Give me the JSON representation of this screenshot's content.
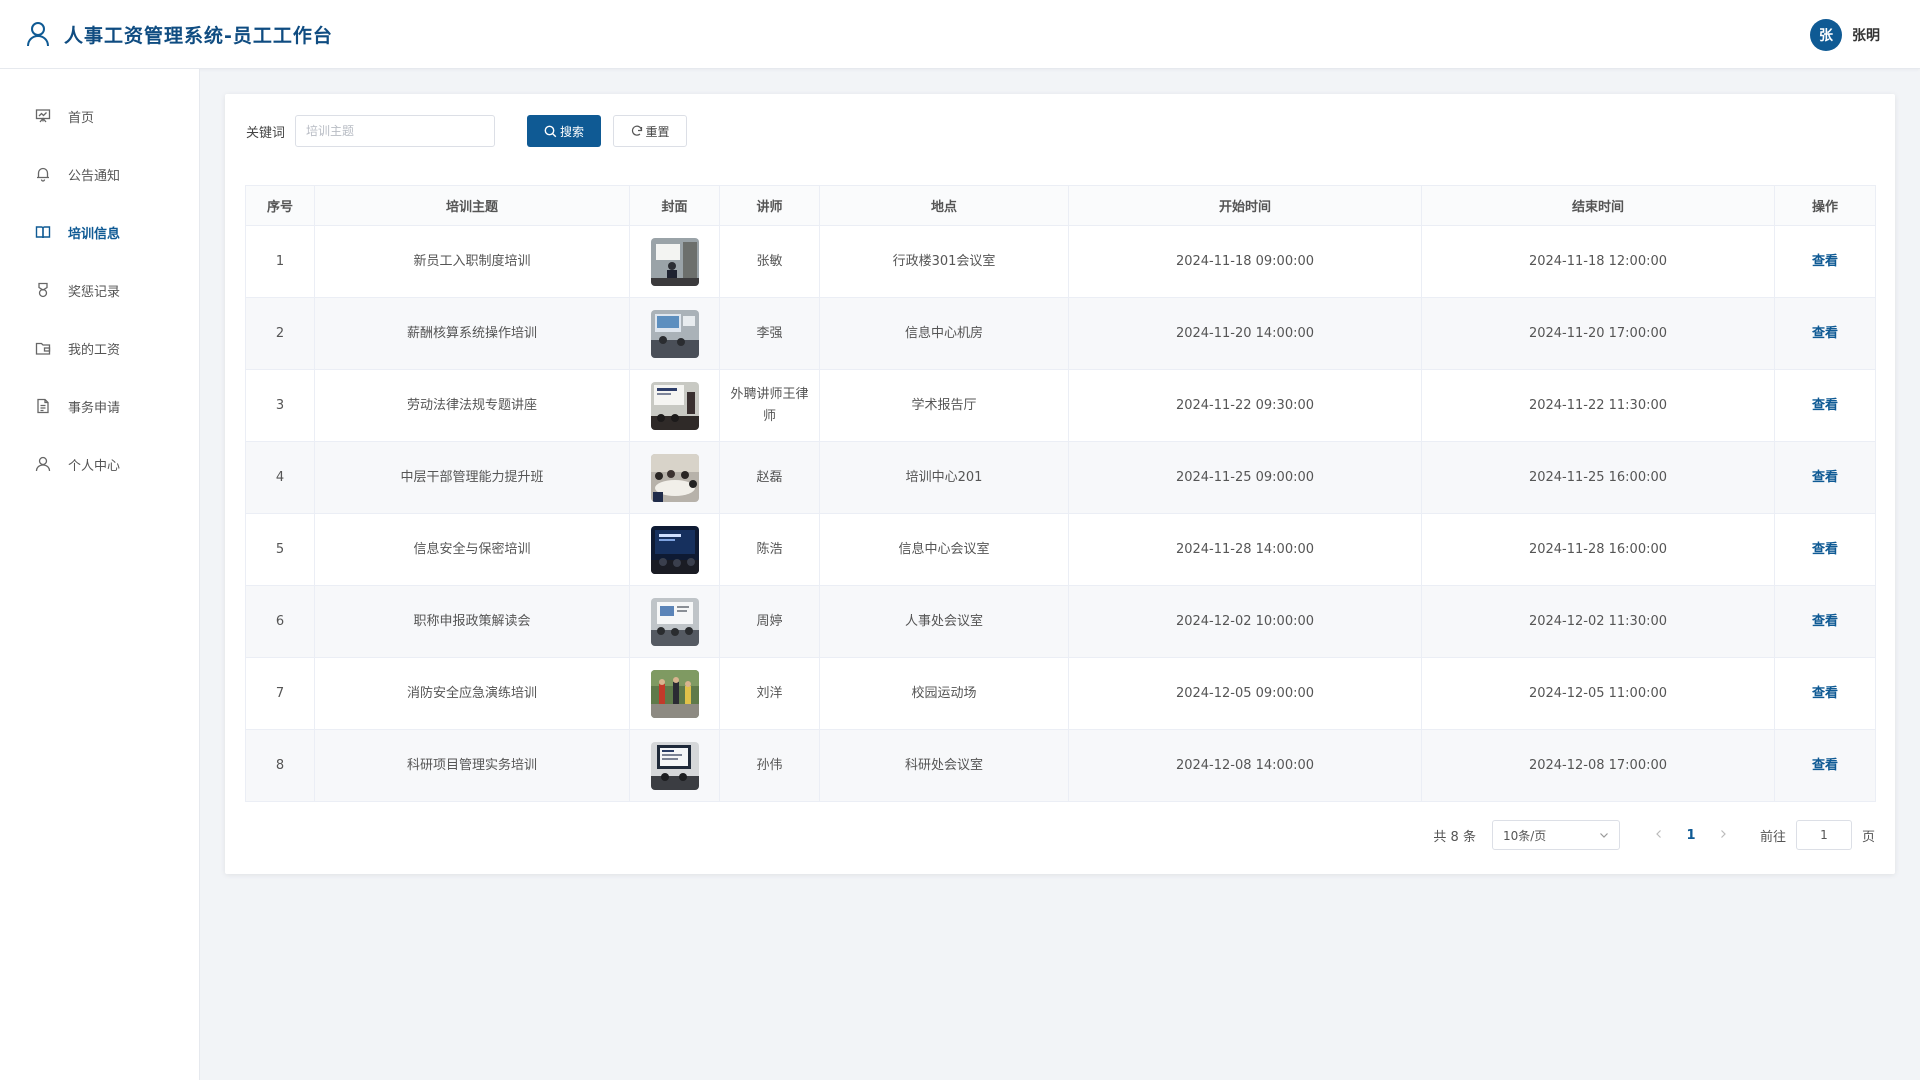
{
  "header": {
    "title": "人事工资管理系统-员工工作台",
    "user_avatar_char": "张",
    "user_name": "张明",
    "accent": "#0f5a94"
  },
  "sidebar": {
    "items": [
      {
        "label": "首页",
        "icon": "presentation-icon",
        "active": false
      },
      {
        "label": "公告通知",
        "icon": "bell-icon",
        "active": false
      },
      {
        "label": "培训信息",
        "icon": "book-icon",
        "active": true
      },
      {
        "label": "奖惩记录",
        "icon": "medal-icon",
        "active": false
      },
      {
        "label": "我的工资",
        "icon": "wallet-icon",
        "active": false
      },
      {
        "label": "事务申请",
        "icon": "document-icon",
        "active": false
      },
      {
        "label": "个人中心",
        "icon": "user-icon",
        "active": false
      }
    ]
  },
  "filter": {
    "label": "关键词",
    "placeholder": "培训主题",
    "value": "",
    "search_label": "搜索",
    "reset_label": "重置"
  },
  "table": {
    "columns": [
      "序号",
      "培训主题",
      "封面",
      "讲师",
      "地点",
      "开始时间",
      "结束时间",
      "操作"
    ],
    "action_label": "查看",
    "rows": [
      {
        "no": "1",
        "topic": "新员工入职制度培训",
        "teacher": "张敏",
        "place": "行政楼301会议室",
        "start": "2024-11-18 09:00:00",
        "end": "2024-11-18 12:00:00"
      },
      {
        "no": "2",
        "topic": "薪酬核算系统操作培训",
        "teacher": "李强",
        "place": "信息中心机房",
        "start": "2024-11-20 14:00:00",
        "end": "2024-11-20 17:00:00"
      },
      {
        "no": "3",
        "topic": "劳动法律法规专题讲座",
        "teacher": "外聘讲师王律师",
        "place": "学术报告厅",
        "start": "2024-11-22 09:30:00",
        "end": "2024-11-22 11:30:00"
      },
      {
        "no": "4",
        "topic": "中层干部管理能力提升班",
        "teacher": "赵磊",
        "place": "培训中心201",
        "start": "2024-11-25 09:00:00",
        "end": "2024-11-25 16:00:00"
      },
      {
        "no": "5",
        "topic": "信息安全与保密培训",
        "teacher": "陈浩",
        "place": "信息中心会议室",
        "start": "2024-11-28 14:00:00",
        "end": "2024-11-28 16:00:00"
      },
      {
        "no": "6",
        "topic": "职称申报政策解读会",
        "teacher": "周婷",
        "place": "人事处会议室",
        "start": "2024-12-02 10:00:00",
        "end": "2024-12-02 11:30:00"
      },
      {
        "no": "7",
        "topic": "消防安全应急演练培训",
        "teacher": "刘洋",
        "place": "校园运动场",
        "start": "2024-12-05 09:00:00",
        "end": "2024-12-05 11:00:00"
      },
      {
        "no": "8",
        "topic": "科研项目管理实务培训",
        "teacher": "孙伟",
        "place": "科研处会议室",
        "start": "2024-12-08 14:00:00",
        "end": "2024-12-08 17:00:00"
      }
    ]
  },
  "pagination": {
    "total_text": "共 8 条",
    "page_size": "10条/页",
    "current_page": "1",
    "goto_label": "前往",
    "goto_value": "1",
    "unit_label": "页"
  }
}
